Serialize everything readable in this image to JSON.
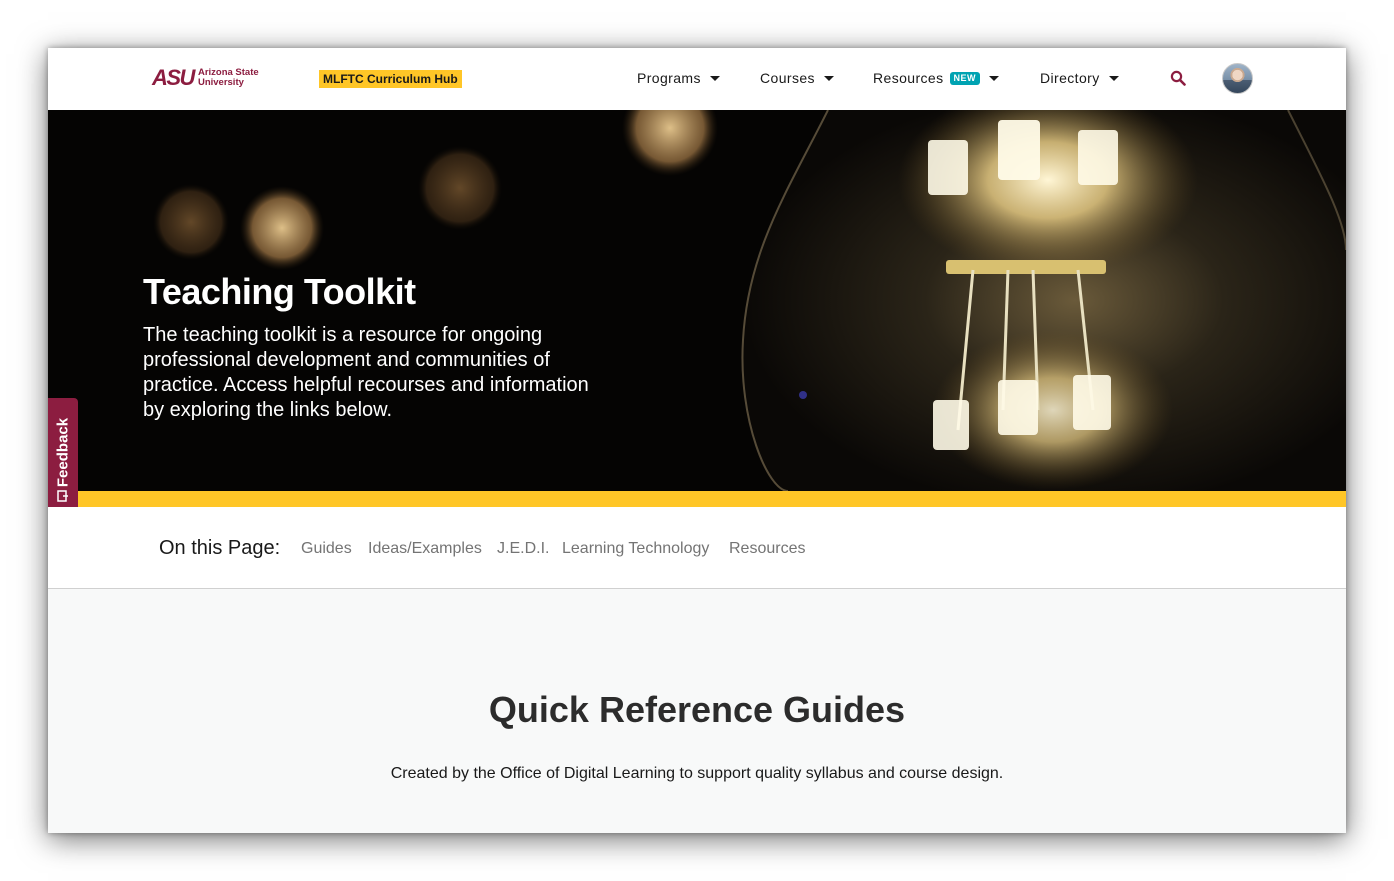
{
  "header": {
    "logo_mark": "ASU",
    "logo_line1": "Arizona State",
    "logo_line2": "University",
    "hub_badge": "MLFTC Curriculum Hub",
    "nav": {
      "programs": "Programs",
      "courses": "Courses",
      "resources": "Resources",
      "resources_badge": "NEW",
      "directory": "Directory"
    },
    "search_icon": "search-icon",
    "avatar_icon": "user-avatar"
  },
  "hero": {
    "title": "Teaching Toolkit",
    "description": "The teaching toolkit is a resource for ongoing professional development and communities of practice. Access helpful recourses and information by exploring the links below."
  },
  "feedback": {
    "label": "Feedback",
    "icon": "feedback-icon"
  },
  "on_this_page": {
    "label": "On this Page:",
    "links": [
      "Guides",
      "Ideas/Examples",
      "J.E.D.I.",
      "Learning Technology",
      "Resources"
    ]
  },
  "main": {
    "title": "Quick Reference Guides",
    "subtitle": "Created by the Office of Digital Learning to support quality syllabus and course design."
  },
  "colors": {
    "maroon": "#8c1d40",
    "gold": "#ffc627",
    "new_badge": "#00a3b2",
    "link_gray": "#747474"
  }
}
